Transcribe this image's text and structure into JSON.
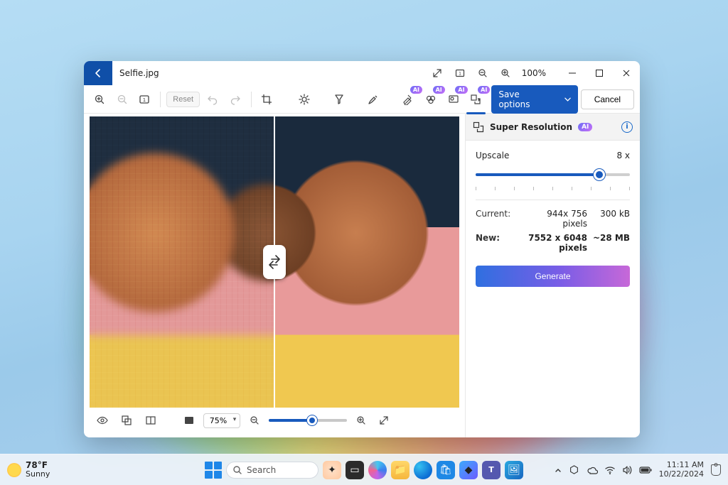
{
  "window": {
    "filename": "Selfie.jpg",
    "top_zoom_label": "100%"
  },
  "toolbar": {
    "reset_label": "Reset",
    "ai_badge": "AI",
    "save_label": "Save options",
    "cancel_label": "Cancel"
  },
  "panel": {
    "title": "Super Resolution",
    "ai_chip": "AI",
    "upscale_label": "Upscale",
    "upscale_value": "8 x",
    "current_label": "Current:",
    "current_dims": "944x 756 pixels",
    "current_size": "300 kB",
    "new_label": "New:",
    "new_dims": "7552 x 6048 pixels",
    "new_size": "~28 MB",
    "generate_label": "Generate"
  },
  "bottombar": {
    "zoom_percent": "75%"
  },
  "taskbar": {
    "temp": "78°F",
    "condition": "Sunny",
    "search_placeholder": "Search",
    "time": "11:11 AM",
    "date": "10/22/2024"
  }
}
